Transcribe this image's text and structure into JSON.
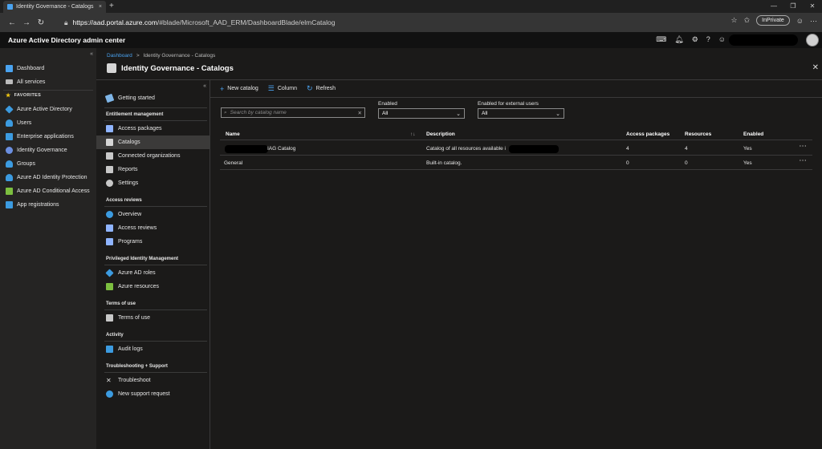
{
  "browser": {
    "tab_title": "Identity Governance - Catalogs",
    "tab_close": "×",
    "new_tab": "+",
    "url_host": "https://aad.portal.azure.com",
    "url_path": "/#blade/Microsoft_AAD_ERM/DashboardBlade/elmCatalog",
    "inprivate": "InPrivate",
    "window_controls": [
      "—",
      "❐",
      "✕"
    ]
  },
  "portal": {
    "title": "Azure Active Directory admin center"
  },
  "left_nav": {
    "collapse": "«",
    "items": [
      {
        "label": "Dashboard",
        "icon": "dashboard-icon",
        "color": "#4aa3f0"
      },
      {
        "label": "All services",
        "icon": "list-icon",
        "color": "#bbbbbb"
      },
      {
        "label": "Azure Active Directory",
        "icon": "aad-diamond-icon",
        "color": "#3c9be0"
      },
      {
        "label": "Users",
        "icon": "user-icon",
        "color": "#3c9be0"
      },
      {
        "label": "Enterprise applications",
        "icon": "apps-grid-icon",
        "color": "#3c9be0"
      },
      {
        "label": "Identity Governance",
        "icon": "governance-icon",
        "color": "#6b8fe0"
      },
      {
        "label": "Groups",
        "icon": "group-icon",
        "color": "#3c9be0"
      },
      {
        "label": "Azure AD Identity Protection",
        "icon": "identity-protection-icon",
        "color": "#3c9be0"
      },
      {
        "label": "Azure AD Conditional Access",
        "icon": "conditional-access-icon",
        "color": "#7cbf3f"
      },
      {
        "label": "App registrations",
        "icon": "app-registrations-icon",
        "color": "#3c9be0"
      }
    ],
    "favorites_label": "FAVORITES"
  },
  "breadcrumb": {
    "root": "Dashboard",
    "sep": ">",
    "current": "Identity Governance - Catalogs"
  },
  "blade": {
    "title": "Identity Governance - Catalogs",
    "close": "✕"
  },
  "resource_menu": {
    "collapse": "«",
    "getting_started": "Getting started",
    "sections": [
      {
        "title": "Entitlement management",
        "items": [
          "Access packages",
          "Catalogs",
          "Connected organizations",
          "Reports",
          "Settings"
        ]
      },
      {
        "title": "Access reviews",
        "items": [
          "Overview",
          "Access reviews",
          "Programs"
        ]
      },
      {
        "title": "Privileged Identity Management",
        "items": [
          "Azure AD roles",
          "Azure resources"
        ]
      },
      {
        "title": "Terms of use",
        "items": [
          "Terms of use"
        ]
      },
      {
        "title": "Activity",
        "items": [
          "Audit logs"
        ]
      },
      {
        "title": "Troubleshooting + Support",
        "items": [
          "Troubleshoot",
          "New support request"
        ]
      }
    ],
    "selected": "Catalogs"
  },
  "toolbar": {
    "new_catalog": "New catalog",
    "column": "Column",
    "refresh": "Refresh"
  },
  "filters": {
    "search_placeholder": "Search by catalog name",
    "enabled_label": "Enabled",
    "enabled_value": "All",
    "external_label": "Enabled for external users",
    "external_value": "All"
  },
  "table": {
    "headers": [
      "Name",
      "Description",
      "Access packages",
      "Resources",
      "Enabled"
    ],
    "rows": [
      {
        "name": "IAG Catalog",
        "description": "Catalog of all resources available i",
        "access_packages": "4",
        "resources": "4",
        "enabled": "Yes",
        "more": "···"
      },
      {
        "name": "General",
        "description": "Built-in catalog.",
        "access_packages": "0",
        "resources": "0",
        "enabled": "Yes",
        "more": "···"
      }
    ]
  }
}
